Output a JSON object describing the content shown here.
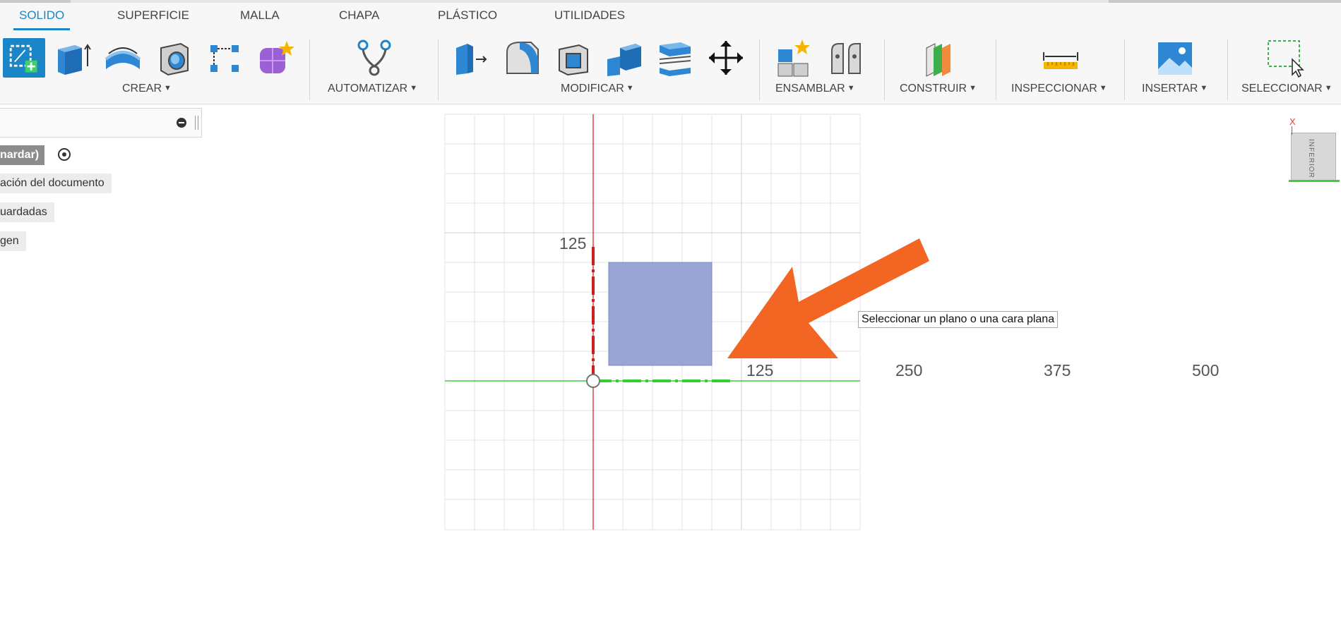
{
  "tabs": [
    "SOLIDO",
    "SUPERFICIE",
    "MALLA",
    "CHAPA",
    "PLÁSTICO",
    "UTILIDADES"
  ],
  "active_tab": "SOLIDO",
  "groups": {
    "crear": "CREAR",
    "automatizar": "AUTOMATIZAR",
    "modificar": "MODIFICAR",
    "ensamblar": "ENSAMBLAR",
    "construir": "CONSTRUIR",
    "inspeccionar": "INSPECCIONAR",
    "insertar": "INSERTAR",
    "seleccionar": "SELECCIONAR"
  },
  "colors": {
    "accent": "#1a86c7",
    "arrow": "#f26522",
    "profile_fill": "#8e9bd0",
    "x_axis": "#e04040",
    "y_axis": "#3ccf3c"
  },
  "browser": {
    "items": [
      "nardar)",
      "ación del documento",
      "uardadas",
      "gen"
    ]
  },
  "canvas": {
    "vertical_tick": "125",
    "horizontal_ticks": [
      "125",
      "250",
      "375",
      "500"
    ],
    "tooltip": "Seleccionar un plano o una cara plana"
  },
  "viewcube": {
    "face": "INFERIOR",
    "axis_label": "X"
  }
}
